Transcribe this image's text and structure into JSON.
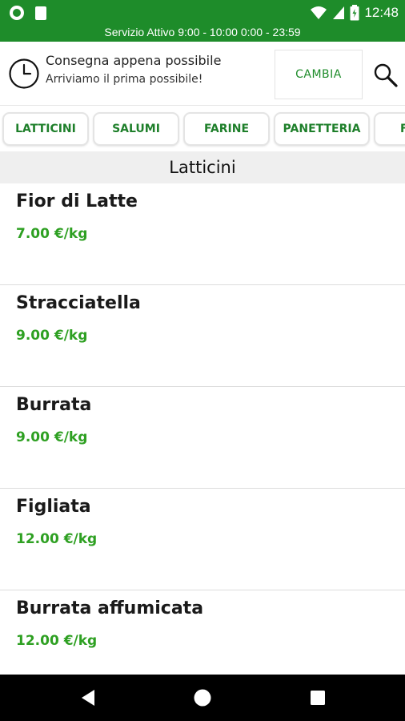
{
  "status_bar": {
    "time": "12:48",
    "service_text": "Servizio Attivo  9:00 - 10:00  0:00 - 23:59",
    "background_color": "#1e8c2a"
  },
  "delivery": {
    "title": "Consegna appena possibile",
    "subtitle": "Arriviamo il prima possibile!",
    "change_label": "CAMBIA",
    "icon": "clock-icon"
  },
  "search": {
    "icon": "search-icon"
  },
  "categories": [
    {
      "label": "LATTICINI"
    },
    {
      "label": "SALUMI"
    },
    {
      "label": "FARINE"
    },
    {
      "label": "PANETTERIA"
    },
    {
      "label": "F"
    }
  ],
  "section": {
    "title": "Latticini"
  },
  "products": [
    {
      "name": "Fior di Latte",
      "price": "7.00 €/kg"
    },
    {
      "name": "Stracciatella",
      "price": "9.00 €/kg"
    },
    {
      "name": "Burrata",
      "price": "9.00 €/kg"
    },
    {
      "name": "Figliata",
      "price": "12.00 €/kg"
    },
    {
      "name": "Burrata affumicata",
      "price": "12.00 €/kg"
    }
  ],
  "nav": {
    "back_icon": "back-icon",
    "home_icon": "home-icon",
    "recents_icon": "recents-icon"
  },
  "colors": {
    "accent": "#1e8c2a",
    "price": "#2ea022"
  }
}
